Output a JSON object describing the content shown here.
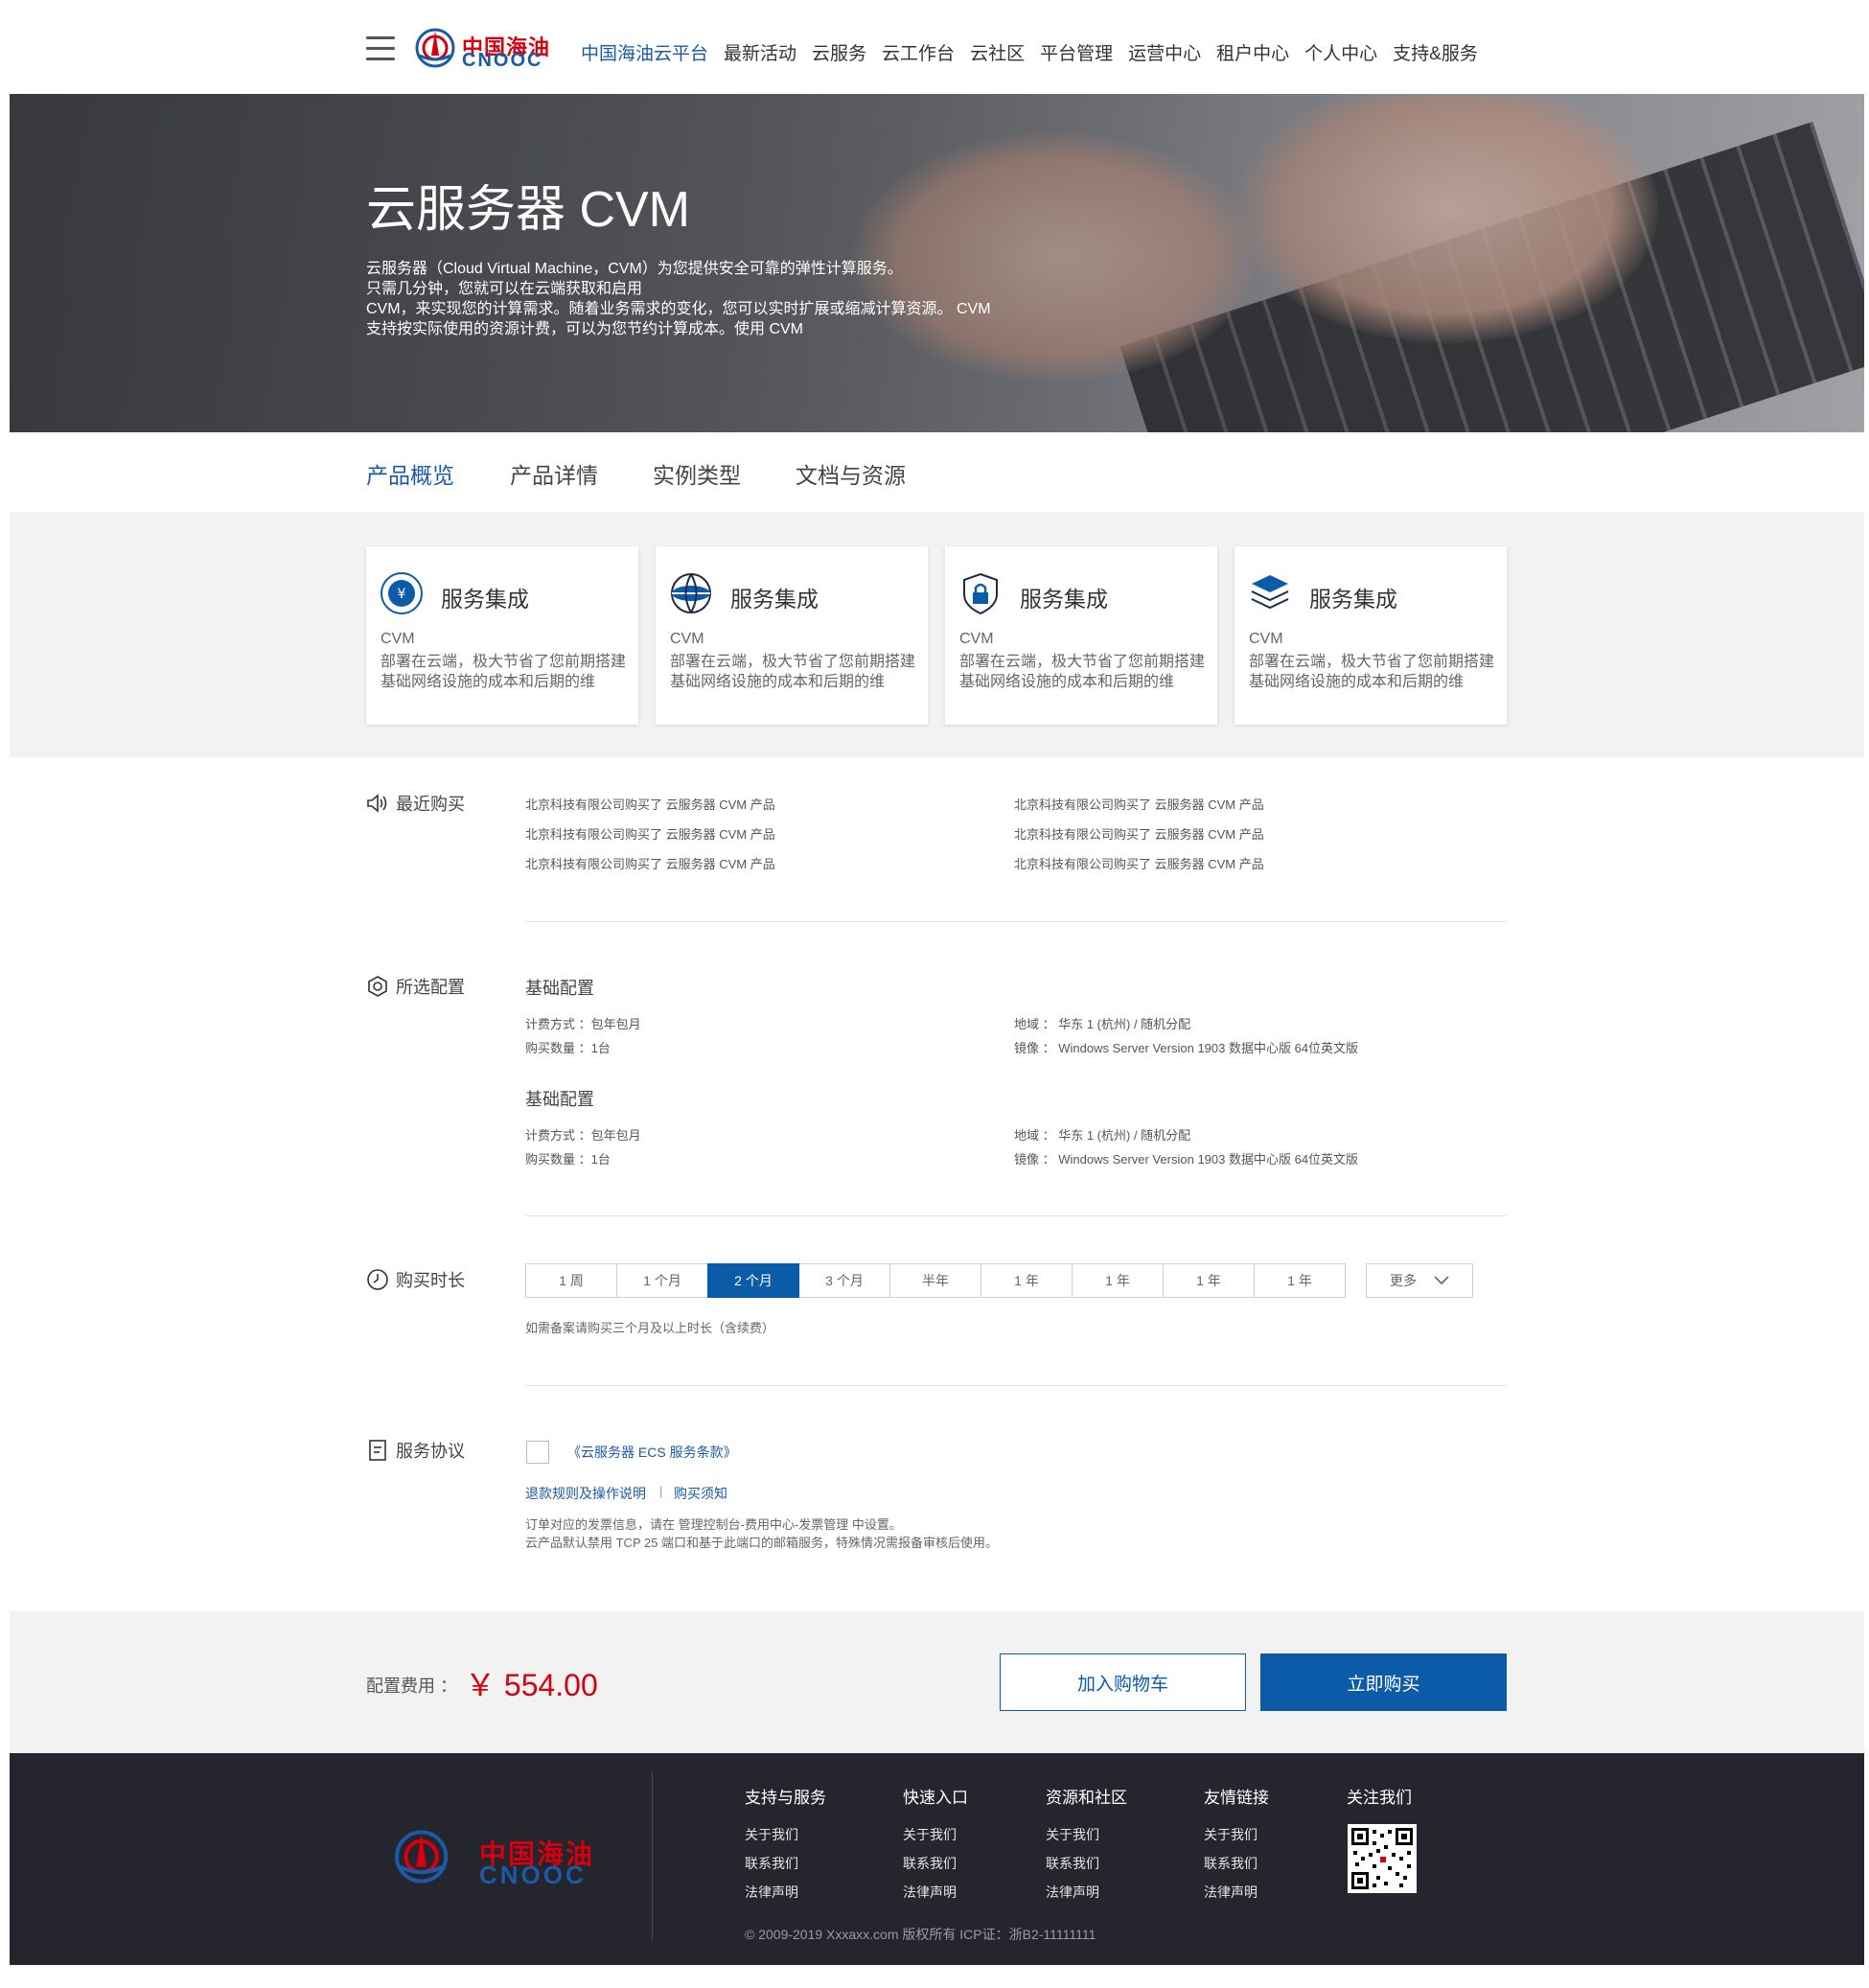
{
  "header": {
    "logo_cn": "中国海油",
    "logo_en": "CNOOC",
    "nav": [
      {
        "label": "中国海油云平台",
        "active": true
      },
      {
        "label": "最新活动"
      },
      {
        "label": "云服务"
      },
      {
        "label": "云工作台"
      },
      {
        "label": "云社区"
      },
      {
        "label": "平台管理"
      },
      {
        "label": "运营中心"
      },
      {
        "label": "租户中心"
      },
      {
        "label": "个人中心"
      },
      {
        "label": "支持&服务"
      }
    ]
  },
  "hero": {
    "title": "云服务器 CVM",
    "desc": [
      "云服务器（Cloud Virtual Machine，CVM）为您提供安全可靠的弹性计算服务。",
      "只需几分钟，您就可以在云端获取和启用",
      "CVM，来实现您的计算需求。随着业务需求的变化，您可以实时扩展或缩减计算资源。 CVM",
      "支持按实际使用的资源计费，可以为您节约计算成本。使用 CVM"
    ]
  },
  "tabs": [
    {
      "label": "产品概览",
      "active": true
    },
    {
      "label": "产品详情"
    },
    {
      "label": "实例类型"
    },
    {
      "label": "文档与资源"
    }
  ],
  "features": [
    {
      "icon": "yen-circle-icon",
      "title": "服务集成",
      "sub": "CVM",
      "desc": "部署在云端，极大节省了您前期搭建基础网络设施的成本和后期的维"
    },
    {
      "icon": "globe-icon",
      "title": "服务集成",
      "sub": "CVM",
      "desc": "部署在云端，极大节省了您前期搭建基础网络设施的成本和后期的维"
    },
    {
      "icon": "shield-lock-icon",
      "title": "服务集成",
      "sub": "CVM",
      "desc": "部署在云端，极大节省了您前期搭建基础网络设施的成本和后期的维"
    },
    {
      "icon": "layers-icon",
      "title": "服务集成",
      "sub": "CVM",
      "desc": "部署在云端，极大节省了您前期搭建基础网络设施的成本和后期的维"
    }
  ],
  "recent": {
    "label": "最近购买",
    "left": [
      "北京科技有限公司购买了 云服务器 CVM 产品",
      "北京科技有限公司购买了 云服务器 CVM 产品",
      "北京科技有限公司购买了 云服务器 CVM 产品"
    ],
    "right": [
      "北京科技有限公司购买了 云服务器 CVM 产品",
      "北京科技有限公司购买了 云服务器 CVM 产品",
      "北京科技有限公司购买了 云服务器 CVM 产品"
    ]
  },
  "config": {
    "label": "所选配置",
    "blocks": [
      {
        "title": "基础配置",
        "billing": "计费方式 ：包年包月",
        "quantity": "购买数量 ：1台",
        "region": "地域 ： 华东 1 (杭州) / 随机分配",
        "image": "镜像 ： Windows Server Version 1903 数据中心版 64位英文版"
      },
      {
        "title": "基础配置",
        "billing": "计费方式 ：包年包月",
        "quantity": "购买数量 ：1台",
        "region": "地域 ： 华东 1 (杭州) / 随机分配",
        "image": "镜像 ： Windows Server Version 1903 数据中心版 64位英文版"
      }
    ]
  },
  "duration": {
    "label": "购买时长",
    "options": [
      "1 周",
      "1 个月",
      "2 个月",
      "3 个月",
      "半年",
      "1 年",
      "1 年",
      "1 年",
      "1 年"
    ],
    "selected_index": 2,
    "more": "更多",
    "note": "如需备案请购买三个月及以上时长（含续费）"
  },
  "agreement": {
    "label": "服务协议",
    "terms_link": "《云服务器 ECS 服务条款》",
    "refund_link": "退款规则及操作说明",
    "separator": "|",
    "notice_link": "购买须知",
    "line1": "订单对应的发票信息，请在 管理控制台-费用中心-发票管理 中设置。",
    "line2": "云产品默认禁用 TCP 25 端口和基于此端口的邮箱服务，特殊情况需报备审核后使用。"
  },
  "price": {
    "label": "配置费用 ：",
    "value": "￥ 554.00",
    "add_to_cart": "加入购物车",
    "buy_now": "立即购买",
    "accent": "#d7000f",
    "primary": "#0b5ba8"
  },
  "footer": {
    "logo_cn": "中国海油",
    "logo_en": "CNOOC",
    "columns": [
      {
        "title": "支持与服务",
        "links": [
          "关于我们",
          "联系我们",
          "法律声明"
        ]
      },
      {
        "title": "快速入口",
        "links": [
          "关于我们",
          "联系我们",
          "法律声明"
        ]
      },
      {
        "title": "资源和社区",
        "links": [
          "关于我们",
          "联系我们",
          "法律声明"
        ]
      },
      {
        "title": "友情链接",
        "links": [
          "关于我们",
          "联系我们",
          "法律声明"
        ]
      }
    ],
    "follow": "关注我们",
    "copyright": "© 2009-2019 Xxxaxx.com 版权所有 ICP证：浙B2-11111111"
  }
}
